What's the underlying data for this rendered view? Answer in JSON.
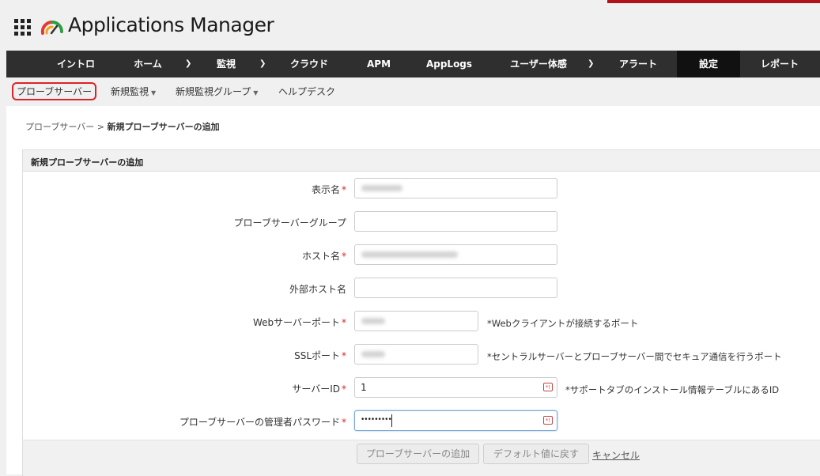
{
  "app": {
    "title": "Applications Manager"
  },
  "nav": {
    "items": [
      {
        "label": "イントロ",
        "has_dropdown": false
      },
      {
        "label": "ホーム",
        "has_dropdown": true
      },
      {
        "label": "監視",
        "has_dropdown": true
      },
      {
        "label": "クラウド",
        "has_dropdown": false
      },
      {
        "label": "APM",
        "has_dropdown": false
      },
      {
        "label": "AppLogs",
        "has_dropdown": false
      },
      {
        "label": "ユーザー体感",
        "has_dropdown": true
      },
      {
        "label": "アラート",
        "has_dropdown": false
      },
      {
        "label": "設定",
        "has_dropdown": false,
        "active": true
      },
      {
        "label": "レポート",
        "has_dropdown": false
      }
    ]
  },
  "subnav": {
    "items": [
      {
        "label": "プローブサーバー",
        "active": true
      },
      {
        "label": "新規監視",
        "has_dropdown": true
      },
      {
        "label": "新規監視グループ",
        "has_dropdown": true
      },
      {
        "label": "ヘルプデスク"
      }
    ]
  },
  "breadcrumb": {
    "parent": "プローブサーバー",
    "separator": ">",
    "current": "新規プローブサーバーの追加"
  },
  "form": {
    "title": "新規プローブサーバーの追加",
    "fields": {
      "display_name": {
        "label": "表示名",
        "required": true,
        "value": ""
      },
      "probe_group": {
        "label": "プローブサーバーグループ",
        "required": false,
        "value": ""
      },
      "host_name": {
        "label": "ホスト名",
        "required": true,
        "value": ""
      },
      "external_host": {
        "label": "外部ホスト名",
        "required": false,
        "value": ""
      },
      "web_port": {
        "label": "Webサーバーポート",
        "required": true,
        "value": "",
        "hint": "*Webクライアントが接続するポート"
      },
      "ssl_port": {
        "label": "SSLポート",
        "required": true,
        "value": "",
        "hint": "*セントラルサーバーとプローブサーバー間でセキュア通信を行うポート"
      },
      "server_id": {
        "label": "サーバーID",
        "required": true,
        "value": "1",
        "hint": "*サポートタブのインストール情報テーブルにあるID"
      },
      "admin_password": {
        "label": "プローブサーバーの管理者パスワード",
        "required": true,
        "value": "•••••••••"
      }
    },
    "required_mark": "*",
    "buttons": {
      "add": "プローブサーバーの追加",
      "reset": "デフォルト値に戻す",
      "cancel": "キャンセル"
    }
  },
  "colors": {
    "nav_bg": "#2f2f2f",
    "nav_active": "#111111",
    "accent": "#b0131b",
    "required": "#d9242a"
  },
  "icons": {
    "chevron": "chevron-down-icon",
    "apps": "apps-grid-icon",
    "key": "password-key-icon"
  }
}
